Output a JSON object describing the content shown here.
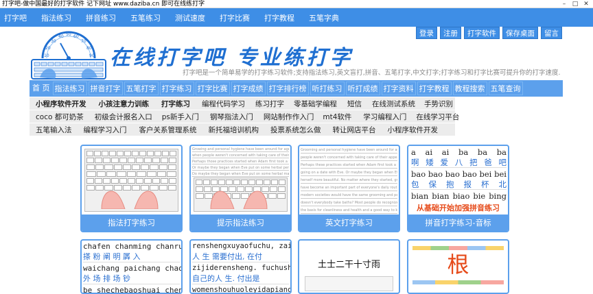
{
  "window": {
    "title": "打字吧-做中国最好的打字软件 记下网址 www.daziba.cn 即可在线练打字",
    "controls": [
      "–",
      "□",
      "✕"
    ]
  },
  "topnav": [
    "打字吧",
    "指法练习",
    "拼音练习",
    "五笔练习",
    "测试速度",
    "打字比赛",
    "打字教程",
    "五笔字典"
  ],
  "header": {
    "slogan": "在线打字吧 专业练打字",
    "description": "打字吧是一个简单易学的打字练习软件;支持指法练习,英文盲打,拼音、五笔打字,中文打字;打字练习和打字比赛可提升你的打字速度.",
    "gauge_numbers": [
      "10",
      "20",
      "30",
      "40",
      "50",
      "60",
      "70",
      "80",
      "90"
    ],
    "user_buttons": [
      "登录",
      "注册",
      "打字软件",
      "保存桌面",
      "留言"
    ]
  },
  "category_bar": [
    "首 页",
    "指法练习",
    "拼音打字",
    "五笔打字",
    "打字练习",
    "打字比赛",
    "打字成绩",
    "打字排行榜",
    "听打练习",
    "听打成绩",
    "打字资料",
    "打字教程",
    "教程搜索",
    "五笔查询"
  ],
  "link_rows": [
    [
      "小程序软件开发",
      "小孩注意力训练",
      "打字练习",
      "编程代码学习",
      "练习打字",
      "零基础学编程",
      "短信",
      "在线测试系统",
      "手势识别"
    ],
    [
      "coco 都可奶茶",
      "初级会计报名入口",
      "ps新手入门",
      "钢琴指法入门",
      "网站制作作入门",
      "mt4软件",
      "学习编程入门",
      "在线学习平台"
    ],
    [
      "五笔输入法",
      "编程学习入门",
      "客户关系管理系统",
      "新托福培训机构",
      "投票系统怎么做",
      "转让网店平台",
      "小程序软件开发"
    ]
  ],
  "cards": [
    {
      "caption": "指法打字练习"
    },
    {
      "caption": "提示指法练习"
    },
    {
      "caption": "英文打字练习"
    },
    {
      "caption": "拼音打字练习-音标"
    }
  ],
  "english_lines_1": [
    "Growing and personal hygiene have been around for ages. It's hard to imagine a time",
    "when people weren't concerned with taking care of their appearance and",
    "Perhaps those practices started when Adam first took a bath and combed his hair",
    "Or maybe they began when Eve put on some herbal perfume",
    "Do maybe they began when Eve put on some herbal makeup"
  ],
  "english_lines_2": [
    "Grooming and personal hygiene have been around for ages. It's hard to imagine",
    "people weren't concerned with taking care of their appearance and the",
    "Perhaps these practices started when Adam first took a bath and combed",
    "going on a date with Eve. Or maybe they began when Eve put on some herbal",
    "herself more beautiful. No matter where they started, grooming and person",
    "have become an important part of everyone's daily routine. You might think",
    "modern societies would have the same grooming and personal hygiene practices",
    "doesn't everybody take baths? Most people do recognize the need for hygiene",
    "the basis for cleanliness and health and a good way to keep one's friends. Growing"
  ],
  "pinyin_card": {
    "rows": [
      {
        "py": [
          "a",
          "ai",
          "ai",
          "ba",
          "ba",
          "ba"
        ],
        "hz": [
          "啊",
          "矮",
          "爱",
          "八",
          "把",
          "爸",
          "吧"
        ]
      },
      {
        "py": [
          "bao",
          "bao",
          "bao",
          "bao",
          "bei",
          "bei"
        ],
        "hz": [
          "包",
          "保",
          "抱",
          "报",
          "杯",
          "北"
        ]
      },
      {
        "py": [
          "bian",
          "bian",
          "biao",
          "bie",
          "bing"
        ],
        "hz": []
      }
    ],
    "footer": "从基础开始加强拼音练习"
  },
  "row2_left": {
    "lines": [
      {
        "py": "chafen chanming chanru",
        "hz": "搽 粉  阐 明  羼 入"
      },
      {
        "py": "waichang paichang chao",
        "hz": "外 场  排 场  钞"
      },
      {
        "py": "be shechebaoshuai chenc",
        "hz": ""
      }
    ]
  },
  "row2_mid": {
    "lines": [
      {
        "py": "renshengxuyaofuchu, zaif",
        "hz": "人 生 需要付出, 在付"
      },
      {
        "py": "zijiderensheng. fuchushi",
        "hz": "自己的人 生. 付出是"
      },
      {
        "py": "womenshouhuoleyidapiangu",
        "hz": ""
      }
    ]
  },
  "row2_wubi": {
    "text": "土士二干十寸雨"
  },
  "row2_char": {
    "text": "根"
  }
}
